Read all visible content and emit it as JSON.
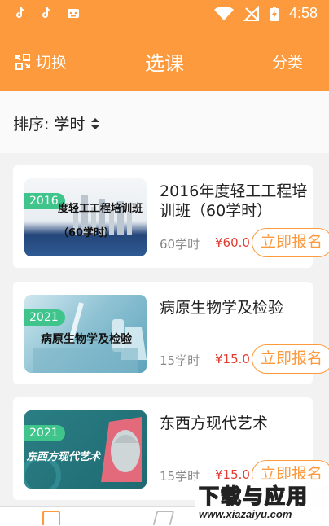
{
  "status_bar": {
    "time": "4:58",
    "icons": [
      "tiktok-icon",
      "tiktok-icon",
      "android-icon",
      "wifi-icon",
      "no-signal-icon",
      "battery-charging-icon"
    ]
  },
  "header": {
    "switch_label": "切换",
    "title": "选课",
    "category_label": "分类"
  },
  "sort": {
    "label": "排序: 学时"
  },
  "courses": [
    {
      "year": "2016",
      "thumb_line1": "度轻工工程培训班",
      "thumb_line2": "（60学时）",
      "title": "2016年度轻工工程培训班（60学时）",
      "hours": "60学时",
      "price": "¥60.0",
      "button": "立即报名"
    },
    {
      "year": "2021",
      "thumb_line1": "病原生物学及检验",
      "title": "病原生物学及检验",
      "hours": "15学时",
      "price": "¥15.0",
      "button": "立即报名"
    },
    {
      "year": "2021",
      "thumb_line1": "东西方现代艺术",
      "title": "东西方现代艺术",
      "hours": "15学时",
      "price": "¥15.0",
      "button": "立即报名"
    }
  ],
  "watermark": {
    "main": "下载与应用",
    "url": "www.xiazaiyu.com"
  },
  "colors": {
    "accent": "#fc9a3d",
    "price": "#e23c30",
    "badge": "#3fc58b"
  }
}
